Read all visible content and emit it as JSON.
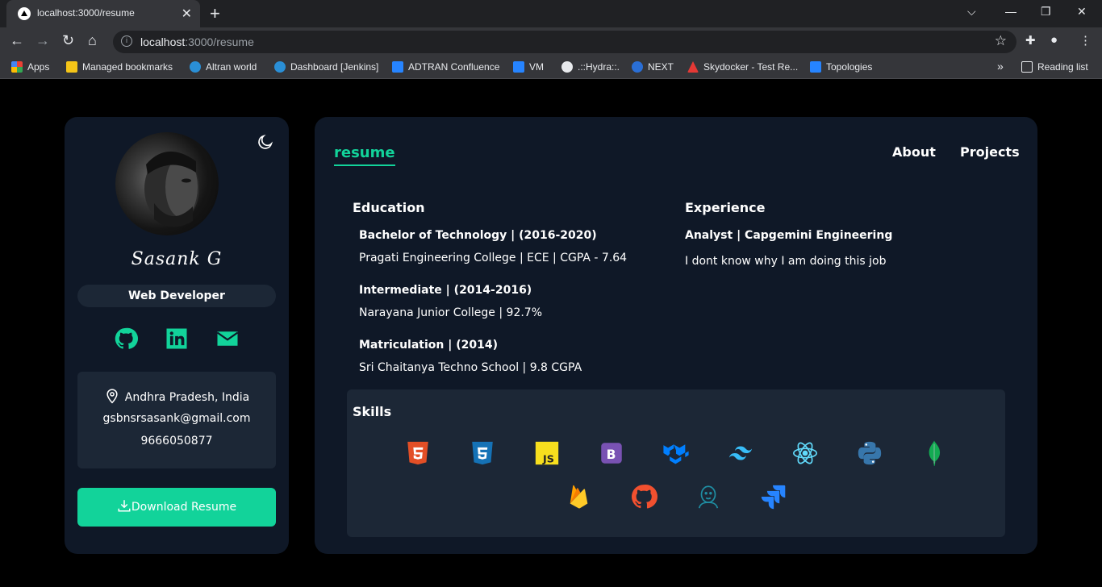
{
  "browser": {
    "tab_title": "localhost:3000/resume",
    "url_host": "localhost",
    "url_rest": ":3000/resume",
    "bookmarks": [
      {
        "label": "Apps",
        "color": "#e94235"
      },
      {
        "label": "Managed bookmarks",
        "color": "#f5c518"
      },
      {
        "label": "Altran world",
        "color": "#2a8fd6"
      },
      {
        "label": "Dashboard [Jenkins]",
        "color": "#2a8fd6"
      },
      {
        "label": "ADTRAN Confluence",
        "color": "#2684ff"
      },
      {
        "label": "VM",
        "color": "#2684ff"
      },
      {
        "label": ".::Hydra::.",
        "color": "#e8eaed"
      },
      {
        "label": "NEXT",
        "color": "#2a6fd6"
      },
      {
        "label": "Skydocker - Test Re...",
        "color": "#e53935"
      },
      {
        "label": "Topologies",
        "color": "#2684ff"
      }
    ],
    "reading_list": "Reading list"
  },
  "profile": {
    "name": "Sasank G",
    "role": "Web Developer",
    "location": "Andhra Pradesh, India",
    "email": "gsbnsrsasank@gmail.com",
    "phone": "9666050877",
    "download_label": "Download Resume",
    "accent_color": "#12d39a"
  },
  "nav": {
    "page_title": "resume",
    "links": [
      "About",
      "Projects"
    ]
  },
  "education": {
    "heading": "Education",
    "items": [
      {
        "title": "Bachelor of Technology | (2016-2020)",
        "detail": "Pragati Engineering College | ECE | CGPA - 7.64"
      },
      {
        "title": "Intermediate | (2014-2016)",
        "detail": "Narayana Junior College | 92.7%"
      },
      {
        "title": "Matriculation | (2014)",
        "detail": "Sri Chaitanya Techno School | 9.8 CGPA"
      }
    ]
  },
  "experience": {
    "heading": "Experience",
    "items": [
      {
        "title": "Analyst | Capgemini Engineering",
        "detail": "I dont know why I am doing this job"
      }
    ]
  },
  "skills": {
    "heading": "Skills",
    "icons": [
      "html5-icon",
      "css3-icon",
      "javascript-icon",
      "bootstrap-icon",
      "material-ui-icon",
      "tailwind-icon",
      "react-icon",
      "python-icon",
      "mongodb-icon",
      "firebase-icon",
      "github-icon",
      "jenkins-icon",
      "jira-icon"
    ]
  }
}
